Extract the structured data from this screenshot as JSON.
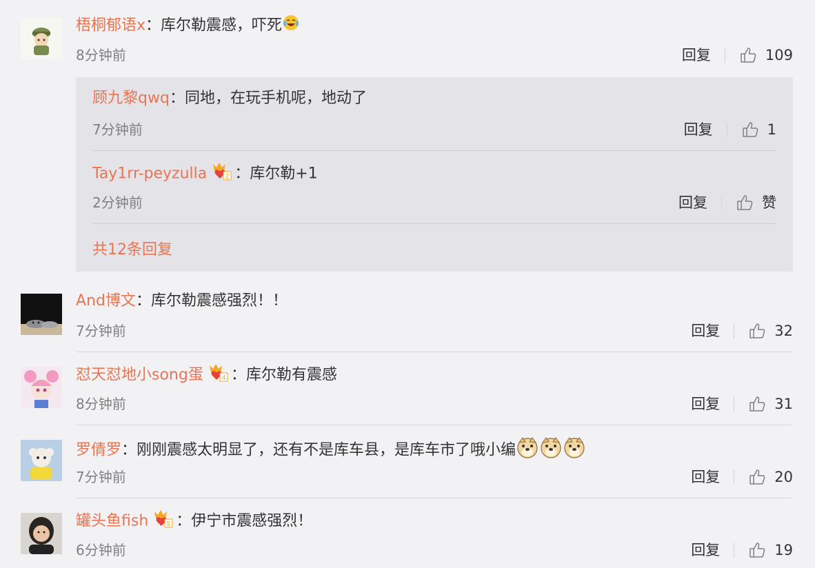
{
  "comments": [
    {
      "user": "梧桐郁语x",
      "sep": "：",
      "text": "库尔勒震感，吓死",
      "time": "8分钟前",
      "reply": "回复",
      "likes": "109",
      "replies": [
        {
          "user": "顾九黎qwq",
          "sep": "：",
          "text": "同地，在玩手机呢，地动了",
          "time": "7分钟前",
          "reply": "回复",
          "likes": "1"
        },
        {
          "user": "Tay1rr-peyzulla",
          "sep": "：",
          "text": "库尔勒+1",
          "time": "2分钟前",
          "reply": "回复",
          "likes": "赞",
          "badge_level": "2"
        }
      ],
      "more_replies": "共12条回复"
    },
    {
      "user": "And博文",
      "sep": "：",
      "text": "库尔勒震感强烈！！",
      "time": "7分钟前",
      "reply": "回复",
      "likes": "32"
    },
    {
      "user": "怼天怼地小song蛋",
      "sep": "：",
      "text": "库尔勒有震感",
      "time": "8分钟前",
      "reply": "回复",
      "likes": "31",
      "badge_level": "4"
    },
    {
      "user": "罗倩罗",
      "sep": "：",
      "text": "刚刚震感太明显了，还有不是库车县，是库车市了哦小编",
      "time": "7分钟前",
      "reply": "回复",
      "likes": "20"
    },
    {
      "user": "罐头鱼fish",
      "sep": "：",
      "text": "伊宁市震感强烈！",
      "time": "6分钟前",
      "reply": "回复",
      "likes": "19",
      "badge_level": "5"
    }
  ],
  "icons": {
    "like": "thumbs-up-icon",
    "laugh_emoji": "laugh-cry-emoji",
    "doge_emoji": "doge-emoji",
    "member_badge": "crown-heart-badge"
  },
  "colors": {
    "username": "#eb7350",
    "background": "#f2f2f5",
    "reply_box": "#e4e4e8"
  }
}
